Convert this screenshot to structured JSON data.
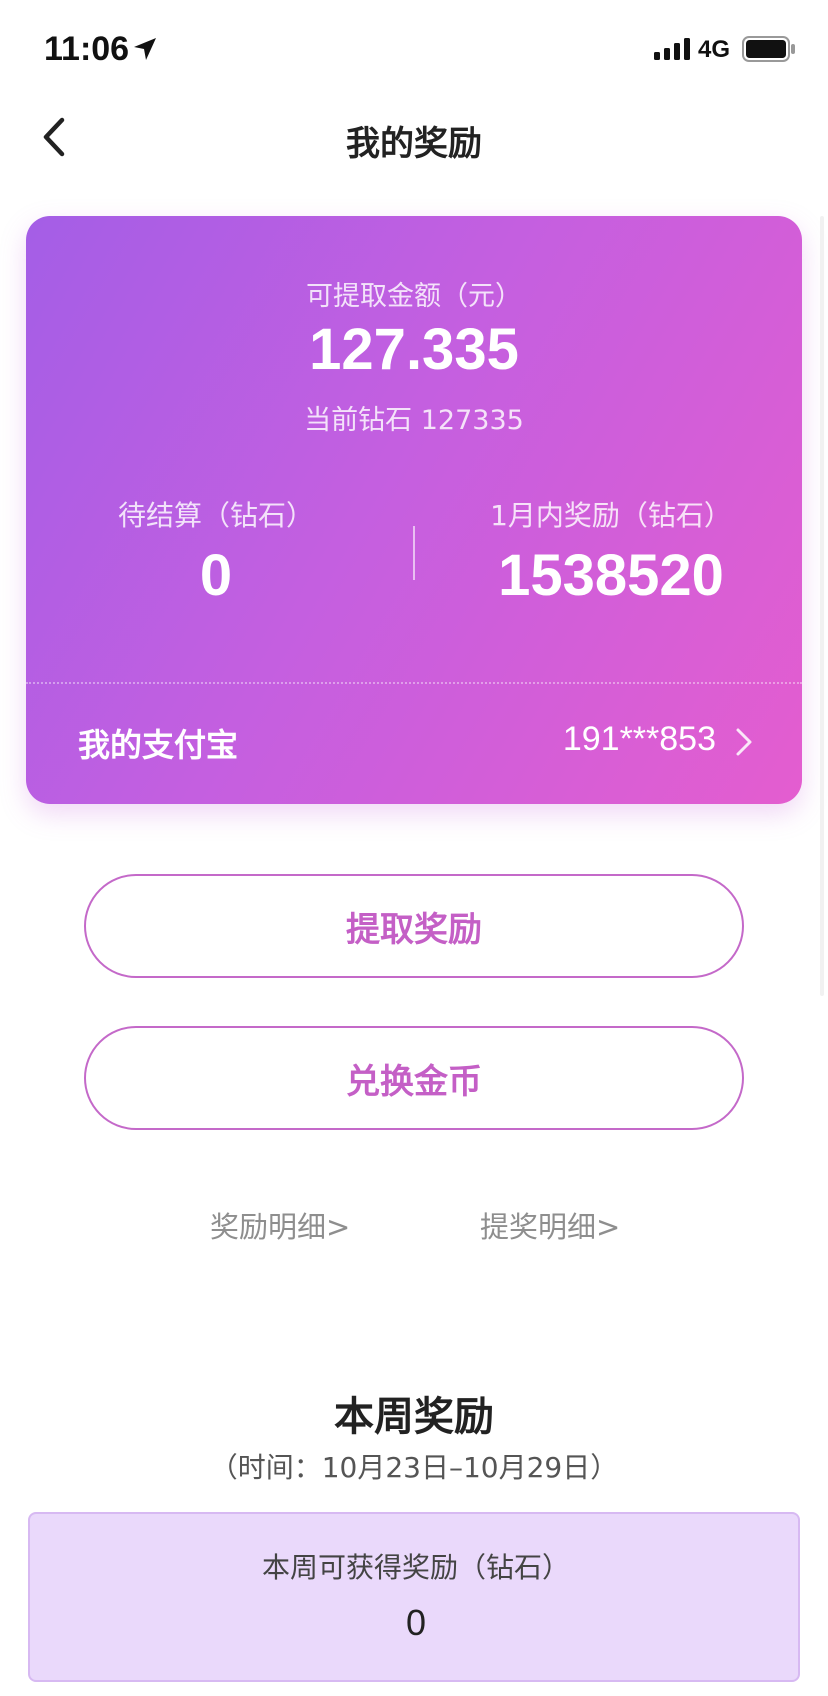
{
  "status_bar": {
    "time": "11:06",
    "network": "4G",
    "icons": [
      "location-arrow-icon",
      "signal-icon",
      "battery-icon"
    ]
  },
  "nav": {
    "title": "我的奖励",
    "back_icon": "chevron-left-icon"
  },
  "card": {
    "withdrawable_label": "可提取金额（元）",
    "withdrawable_amount": "127.335",
    "current_diamonds": "当前钻石 127335",
    "pending_label": "待结算（钻石）",
    "pending_value": "0",
    "month_reward_label": "1月内奖励（钻石）",
    "month_reward_value": "1538520",
    "alipay_label": "我的支付宝",
    "alipay_account": "191***853",
    "gradient_colors": [
      "#a45ee6",
      "#c45fe0",
      "#e45dcf"
    ]
  },
  "actions": {
    "withdraw_label": "提取奖励",
    "exchange_label": "兑换金币",
    "accent_color": "#c45fc6"
  },
  "links": {
    "reward_detail": "奖励明细>",
    "withdraw_detail": "提奖明细>"
  },
  "weekly": {
    "title": "本周奖励",
    "period": "（时间：10月23日–10月29日）",
    "box_label": "本周可获得奖励（钻石）",
    "box_value": "0",
    "box_color": "#ead9fb"
  }
}
